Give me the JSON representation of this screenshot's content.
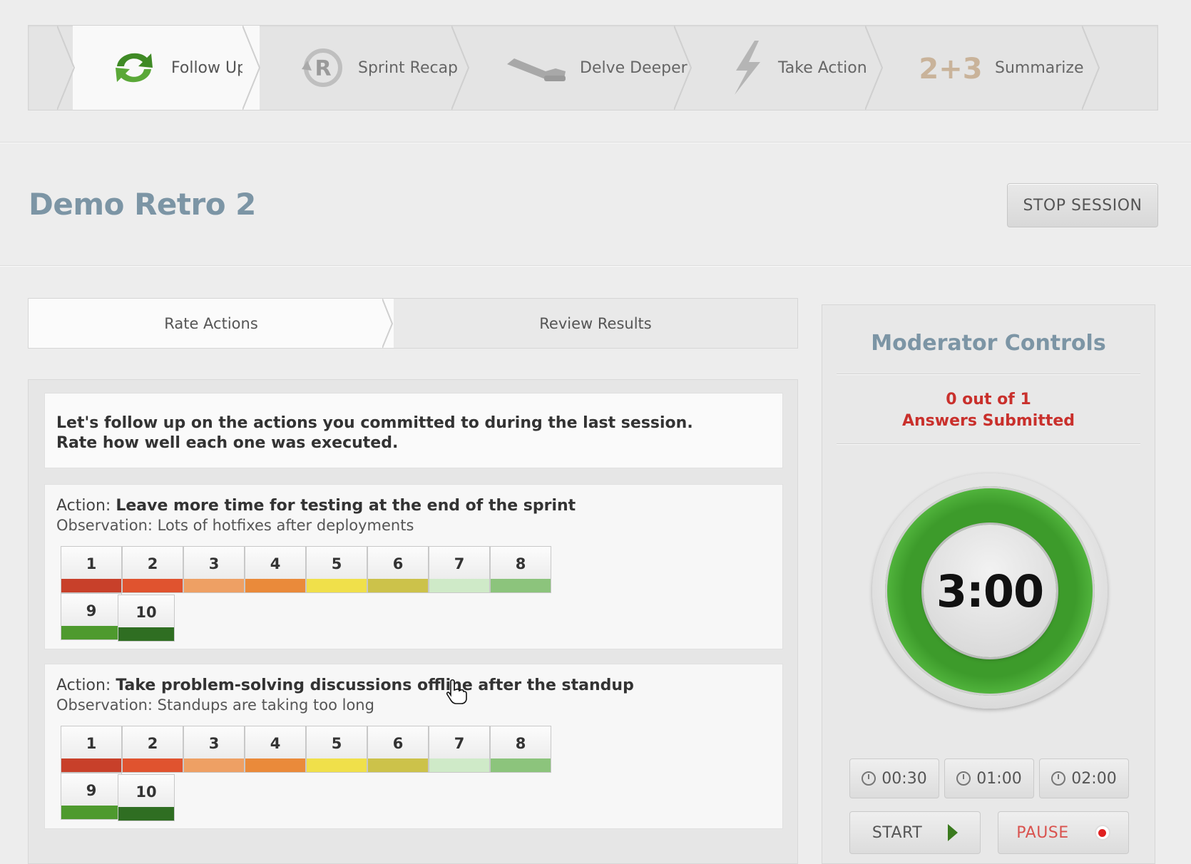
{
  "steps": [
    {
      "label": "Follow Up",
      "icon": "refresh-arrows-icon",
      "active": true
    },
    {
      "label": "Sprint Recap",
      "icon": "recap-r-icon",
      "active": false
    },
    {
      "label": "Delve Deeper",
      "icon": "slide-icon",
      "active": false
    },
    {
      "label": "Take Action",
      "icon": "lightning-icon",
      "active": false
    },
    {
      "label": "Summarize",
      "icon": "math-sum-icon",
      "icon_text": "2+3",
      "active": false
    }
  ],
  "page": {
    "title": "Demo Retro 2",
    "stop_label": "STOP SESSION"
  },
  "subtabs": [
    {
      "label": "Rate Actions",
      "active": true
    },
    {
      "label": "Review Results",
      "active": false
    }
  ],
  "intro": {
    "line1": "Let's follow up on the actions you committed to during the last session.",
    "line2": "Rate how well each one was executed."
  },
  "actions": [
    {
      "action_prefix": "Action: ",
      "action": "Leave more time for testing at the end of the sprint",
      "observation": "Observation: Lots of hotfixes after deployments"
    },
    {
      "action_prefix": "Action: ",
      "action": "Take problem-solving discussions offline after the standup",
      "observation": "Observation: Standups are taking too long"
    }
  ],
  "ratings": [
    "1",
    "2",
    "3",
    "4",
    "5",
    "6",
    "7",
    "8",
    "9",
    "10"
  ],
  "rating_colors": [
    "#c8402a",
    "#e0532f",
    "#eea064",
    "#ea8a3a",
    "#f0e04a",
    "#ccc24a",
    "#cfeac8",
    "#8cc47c",
    "#4e9a2e",
    "#2f6e22"
  ],
  "moderator": {
    "title": "Moderator Controls",
    "answers_line1": "0 out of 1",
    "answers_line2": "Answers Submitted",
    "timer": "3:00",
    "presets": [
      "00:30",
      "01:00",
      "02:00"
    ],
    "start_label": "START",
    "pause_label": "PAUSE"
  },
  "colors": {
    "accent_title": "#7c95a5",
    "alert_red": "#c9302c",
    "timer_green": "#3d9b2b"
  }
}
